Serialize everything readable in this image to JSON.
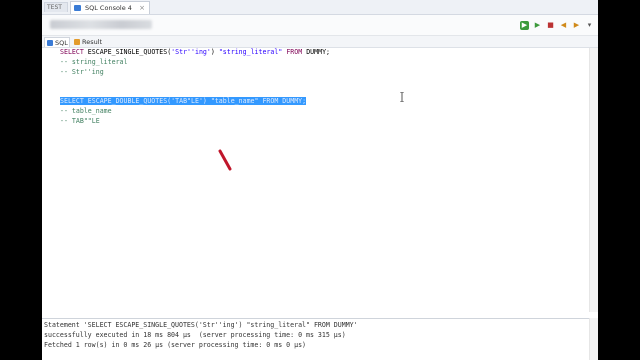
{
  "window": {
    "tabs": [
      {
        "label": "TEST"
      },
      {
        "label": "SQL Console 4",
        "close": "×"
      }
    ],
    "toolbar_icons": [
      "run-icon",
      "run-selected-icon",
      "stop-icon",
      "history-back-icon",
      "history-forward-icon",
      "dropdown-icon"
    ]
  },
  "subtabs": [
    {
      "label": "SQL"
    },
    {
      "label": "Result"
    }
  ],
  "editor": {
    "line1": {
      "kw1": "SELECT",
      "fn": " ESCAPE_SINGLE_QUOTES(",
      "str1": "'Str''ing'",
      "mid": ") ",
      "str2": "\"string_literal\"",
      "kw2": " FROM",
      "tail": " DUMMY;"
    },
    "line2": "-- string_literal",
    "line3": "-- Str''ing",
    "line4": "SELECT ESCAPE_DOUBLE_QUOTES('TAB\"LE') \"table_name\" FROM DUMMY;",
    "line5": "-- table_name",
    "line6": "-- TAB\"\"LE"
  },
  "console": {
    "line1": "Statement 'SELECT ESCAPE_SINGLE_QUOTES('Str''ing') \"string_literal\" FROM DUMMY'",
    "line2": "successfully executed in 18 ms 804 µs  (server processing time: 0 ms 315 µs)",
    "line3": "Fetched 1 row(s) in 0 ms 26 µs (server processing time: 0 ms 0 µs)"
  },
  "colors": {
    "keyword": "#7f0055",
    "string": "#2a00ff",
    "comment": "#3f7f5f",
    "selection": "#3399ff"
  }
}
